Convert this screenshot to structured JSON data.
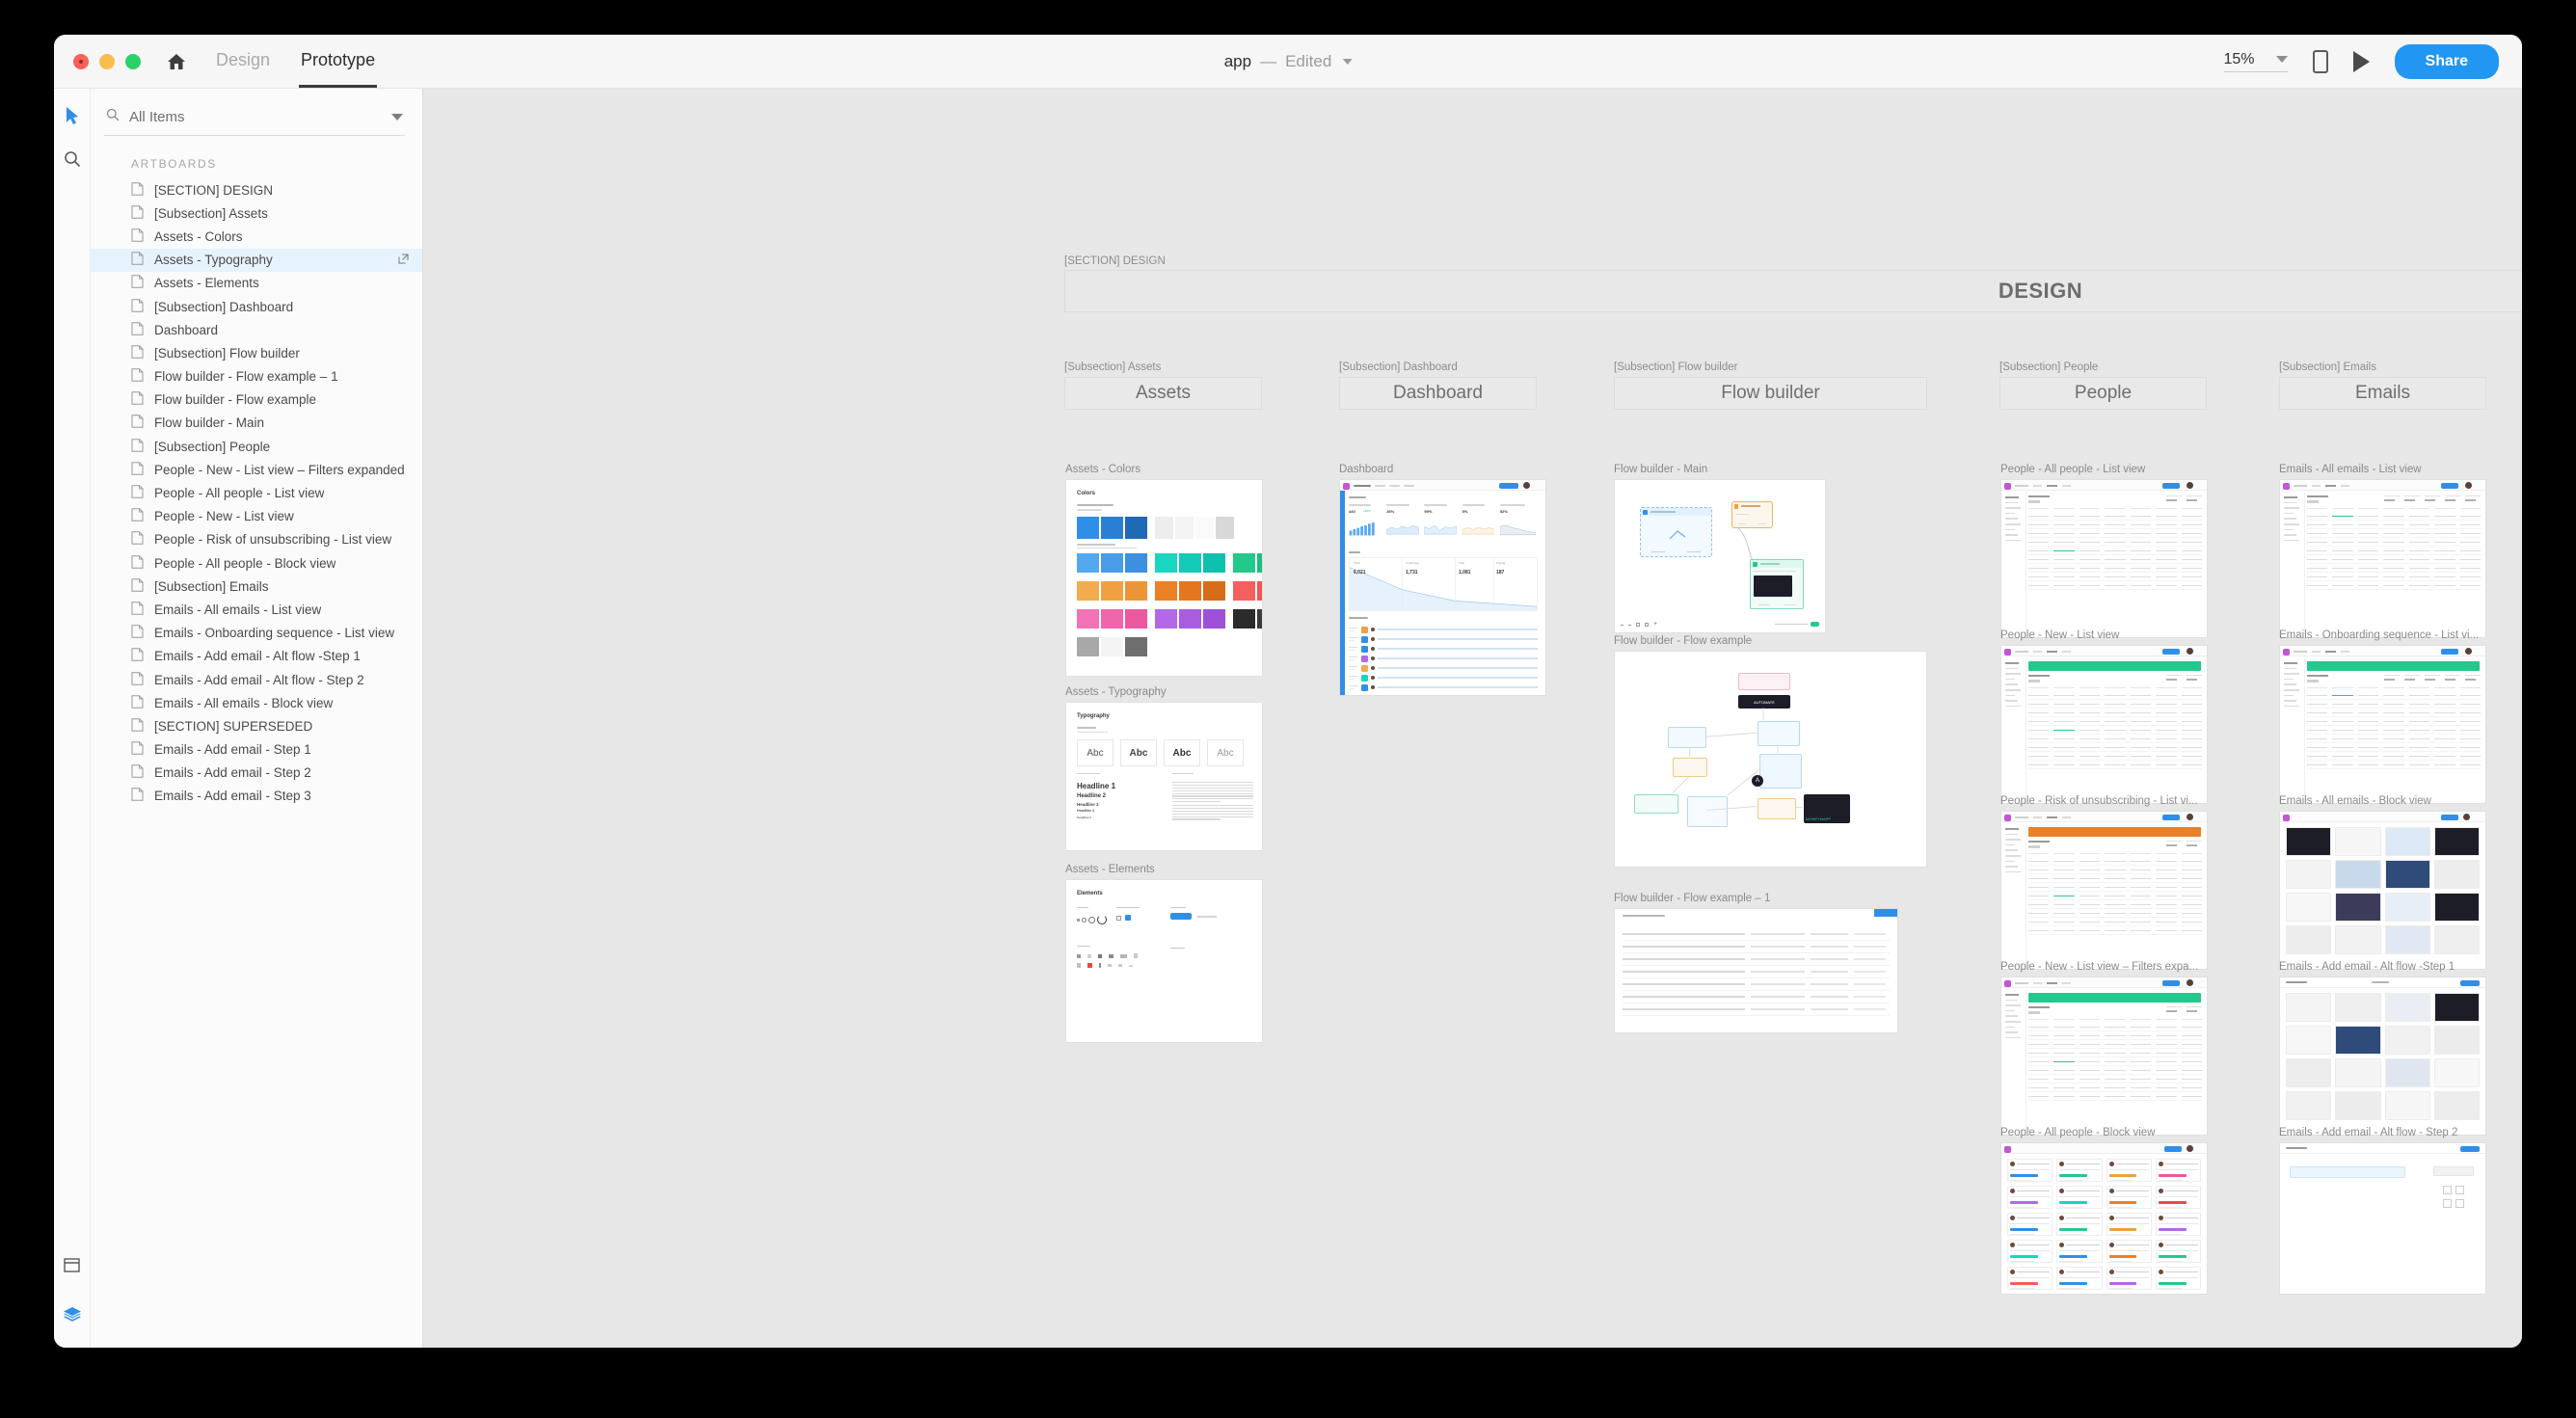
{
  "window": {
    "traffic_lights": [
      "close",
      "minimize",
      "maximize"
    ],
    "home_icon": "home-icon",
    "tabs": [
      {
        "label": "Design",
        "active": false
      },
      {
        "label": "Prototype",
        "active": true
      }
    ],
    "document": {
      "name": "app",
      "separator": "—",
      "state": "Edited",
      "dropdown_icon": "chevron-down-icon"
    },
    "toolbar_right": {
      "zoom_level": "15%",
      "zoom_dropdown_icon": "chevron-down-icon",
      "preview_device_icon": "phone-icon",
      "play_icon": "play-icon",
      "share_label": "Share",
      "share_color": "#2196f3"
    }
  },
  "rail": {
    "items": [
      {
        "icon": "cursor-arrow-icon",
        "active": true
      },
      {
        "icon": "search-icon",
        "active": false
      }
    ],
    "bottom_items": [
      {
        "icon": "artboard-icon"
      },
      {
        "icon": "layers-icon",
        "color": "#2f8fe8"
      }
    ]
  },
  "sidebar": {
    "search": {
      "icon": "search-icon",
      "value": "All Items",
      "placeholder": "All Items",
      "dropdown_icon": "chevron-down-icon"
    },
    "section_label": "ARTBOARDS",
    "items": [
      {
        "label": "[SECTION] DESIGN",
        "selected": false,
        "link": false
      },
      {
        "label": "[Subsection] Assets",
        "selected": false,
        "link": false
      },
      {
        "label": "Assets - Colors",
        "selected": false,
        "link": false
      },
      {
        "label": "Assets - Typography",
        "selected": true,
        "link": true
      },
      {
        "label": "Assets - Elements",
        "selected": false,
        "link": false
      },
      {
        "label": "[Subsection] Dashboard",
        "selected": false,
        "link": false
      },
      {
        "label": "Dashboard",
        "selected": false,
        "link": false
      },
      {
        "label": "[Subsection] Flow builder",
        "selected": false,
        "link": false
      },
      {
        "label": "Flow builder - Flow example – 1",
        "selected": false,
        "link": false
      },
      {
        "label": "Flow builder - Flow example",
        "selected": false,
        "link": false
      },
      {
        "label": "Flow builder - Main",
        "selected": false,
        "link": false
      },
      {
        "label": "[Subsection] People",
        "selected": false,
        "link": false
      },
      {
        "label": "People - New - List view – Filters expanded",
        "selected": false,
        "link": false
      },
      {
        "label": "People - All people - List view",
        "selected": false,
        "link": false
      },
      {
        "label": "People - New - List view",
        "selected": false,
        "link": false
      },
      {
        "label": "People - Risk of unsubscribing - List view",
        "selected": false,
        "link": false
      },
      {
        "label": "People - All people - Block view",
        "selected": false,
        "link": false
      },
      {
        "label": "[Subsection] Emails",
        "selected": false,
        "link": false
      },
      {
        "label": "Emails - All emails - List view",
        "selected": false,
        "link": false
      },
      {
        "label": "Emails - Onboarding sequence - List view",
        "selected": false,
        "link": false
      },
      {
        "label": "Emails - Add email - Alt flow -Step 1",
        "selected": false,
        "link": false
      },
      {
        "label": "Emails - Add email - Alt flow - Step 2",
        "selected": false,
        "link": false
      },
      {
        "label": "Emails - All emails - Block view",
        "selected": false,
        "link": false
      },
      {
        "label": "[SECTION] SUPERSEDED",
        "selected": false,
        "link": false
      },
      {
        "label": "Emails - Add email - Step 1",
        "selected": false,
        "link": false
      },
      {
        "label": "Emails - Add email - Step 2",
        "selected": false,
        "link": false
      },
      {
        "label": "Emails - Add email - Step 3",
        "selected": false,
        "link": false
      }
    ]
  },
  "canvas": {
    "section": {
      "caption": "[SECTION] DESIGN",
      "banner_text": "DESIGN"
    },
    "subsections": [
      {
        "caption": "[Subsection] Assets",
        "banner_text": "Assets"
      },
      {
        "caption": "[Subsection] Dashboard",
        "banner_text": "Dashboard"
      },
      {
        "caption": "[Subsection] Flow builder",
        "banner_text": "Flow builder"
      },
      {
        "caption": "[Subsection] People",
        "banner_text": "People"
      },
      {
        "caption": "[Subsection] Emails",
        "banner_text": "Emails"
      }
    ],
    "artboards": {
      "col1": [
        {
          "label": "Assets - Colors",
          "title": "Colors"
        },
        {
          "label": "Assets - Typography",
          "title": "Typography"
        },
        {
          "label": "Assets - Elements",
          "title": "Elements"
        }
      ],
      "col2": [
        {
          "label": "Dashboard"
        }
      ],
      "col3": [
        {
          "label": "Flow builder - Main"
        },
        {
          "label": "Flow builder - Flow example"
        },
        {
          "label": "Flow builder - Flow example – 1"
        }
      ],
      "col4": [
        {
          "label": "People - All people - List view"
        },
        {
          "label": "People - New - List view"
        },
        {
          "label": "People - Risk of unsubscribing - List vi..."
        },
        {
          "label": "People - New - List view – Filters expa..."
        },
        {
          "label": "People - All people - Block view"
        }
      ],
      "col5": [
        {
          "label": "Emails - All emails - List view"
        },
        {
          "label": "Emails - Onboarding sequence - List vi..."
        },
        {
          "label": "Emails - All emails - Block view"
        },
        {
          "label": "Emails - Add email - Alt flow -Step 1"
        },
        {
          "label": "Emails - Add email - Alt flow - Step 2"
        }
      ]
    },
    "typography_samples": {
      "specimens": [
        "Abc",
        "Abc",
        "Abc",
        "Abc"
      ],
      "headlines": [
        "Headline 1",
        "Headline 2",
        "Headline 3",
        "Headline 4",
        "Headline 5"
      ]
    },
    "color_palette": [
      "#2f8fe8",
      "#2a7fd4",
      "#1f69b5",
      "#ededed",
      "#f4f4f4",
      "#fafafa",
      "#d8d8d8",
      "#55a8ef",
      "#4a9ce8",
      "#3d90e0",
      "#17d6c2",
      "#12cbb8",
      "#0ec0ae",
      "#23c98a",
      "#1cbd80",
      "#16b176",
      "#f4ab4e",
      "#f0a042",
      "#ec9537",
      "#ec8025",
      "#e3761e",
      "#d96c18",
      "#f2605f",
      "#ee5553",
      "#e84a49",
      "#f472b6",
      "#f065ab",
      "#ec58a0",
      "#b368e8",
      "#a95ce0",
      "#9f50d8",
      "#2b2b2b",
      "#3a3a3a",
      "#222222",
      "#a8a8a8",
      "#f4f4f4",
      "#6e6e6e"
    ]
  }
}
